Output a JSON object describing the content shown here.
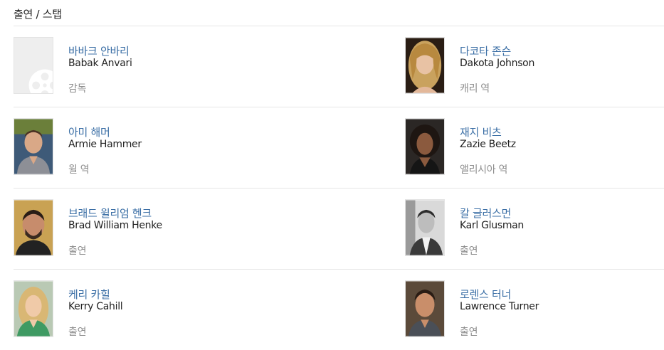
{
  "section": {
    "title": "출연 / 스탭"
  },
  "cast": [
    {
      "name_ko": "바바크 안바리",
      "name_en": "Babak Anvari",
      "role": "감독",
      "photo": "placeholder-film-icon"
    },
    {
      "name_ko": "다코타 존슨",
      "name_en": "Dakota Johnson",
      "role": "캐리 역",
      "photo": "headshot"
    },
    {
      "name_ko": "아미 해머",
      "name_en": "Armie Hammer",
      "role": "윌 역",
      "photo": "headshot"
    },
    {
      "name_ko": "재지 비츠",
      "name_en": "Zazie Beetz",
      "role": "앨리시아 역",
      "photo": "headshot"
    },
    {
      "name_ko": "브래드 윌리엄 헨크",
      "name_en": "Brad William Henke",
      "role": "출연",
      "photo": "headshot"
    },
    {
      "name_ko": "칼 글러스먼",
      "name_en": "Karl Glusman",
      "role": "출연",
      "photo": "headshot"
    },
    {
      "name_ko": "케리 카힐",
      "name_en": "Kerry Cahill",
      "role": "출연",
      "photo": "headshot"
    },
    {
      "name_ko": "로렌스 터너",
      "name_en": "Lawrence Turner",
      "role": "출연",
      "photo": "headshot"
    }
  ],
  "colors": {
    "link": "#3a6ea5",
    "name_en": "#222222",
    "role": "#8c8c8c",
    "divider": "#e6e6e6",
    "placeholder_bg": "#eeeeee"
  }
}
